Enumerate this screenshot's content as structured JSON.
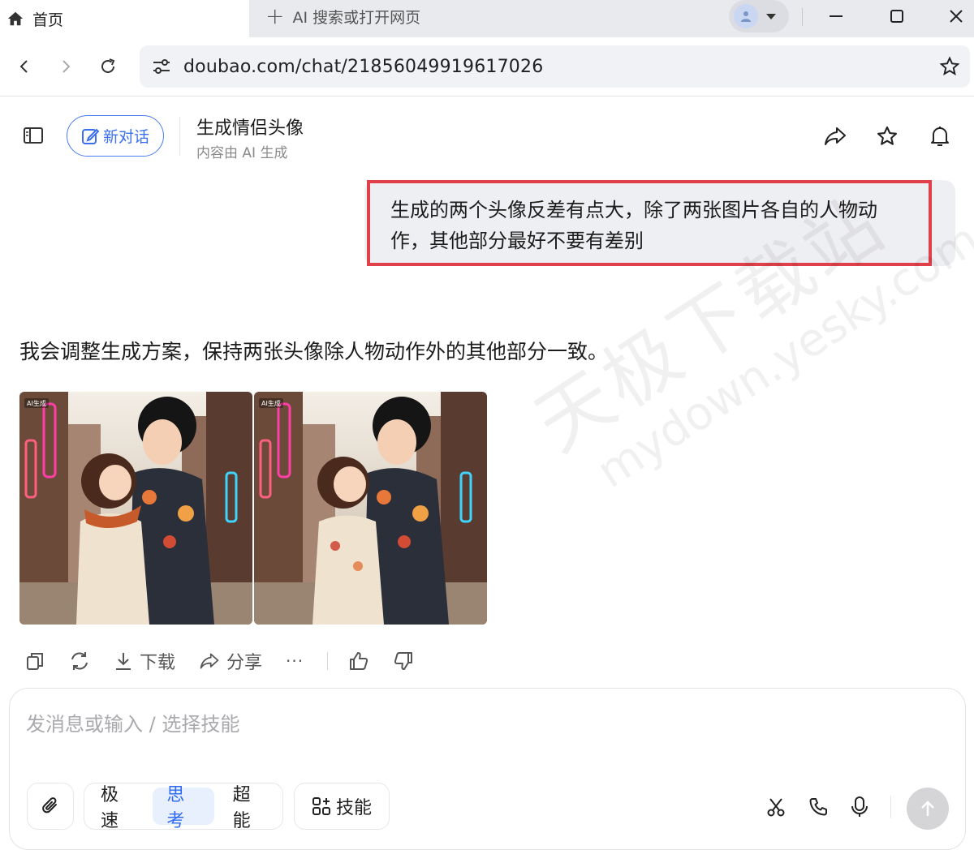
{
  "browser": {
    "active_tab": {
      "icon": "home-icon",
      "label": "首页"
    },
    "new_tab": {
      "icon": "plus-icon",
      "label": "AI 搜索或打开网页"
    },
    "profile_icon": "profile-avatar-icon",
    "address": {
      "url": "doubao.com/chat/21856049919617026",
      "icon": "site-settings-icon"
    }
  },
  "header": {
    "new_chat_label": "新对话",
    "title": "生成情侣头像",
    "subtitle": "内容由 AI 生成"
  },
  "conversation": {
    "user_message": "生成的两个头像反差有点大，除了两张图片各自的人物动作，其他部分最好不要有差别",
    "assistant_reply": "我会调整生成方案，保持两张头像除人物动作外的其他部分一致。",
    "images": [
      {
        "badge": "AI生成",
        "description_icon": "couple-avatar-image"
      },
      {
        "badge": "AI生成",
        "description_icon": "couple-avatar-image"
      }
    ]
  },
  "actions": {
    "download_label": "下载",
    "share_label": "分享",
    "more_label": "···"
  },
  "composer": {
    "placeholder": "发消息或输入 / 选择技能",
    "modes": [
      "极速",
      "思考",
      "超能"
    ],
    "selected_mode": "思考",
    "skills_label": "技能"
  },
  "watermark": {
    "text_cn": "天极下载站",
    "text_url": "mydown.yesky.com"
  },
  "colors": {
    "accent": "#3a6ff0",
    "highlight_border": "#e0404a",
    "bubble_bg": "#eeeff3"
  }
}
